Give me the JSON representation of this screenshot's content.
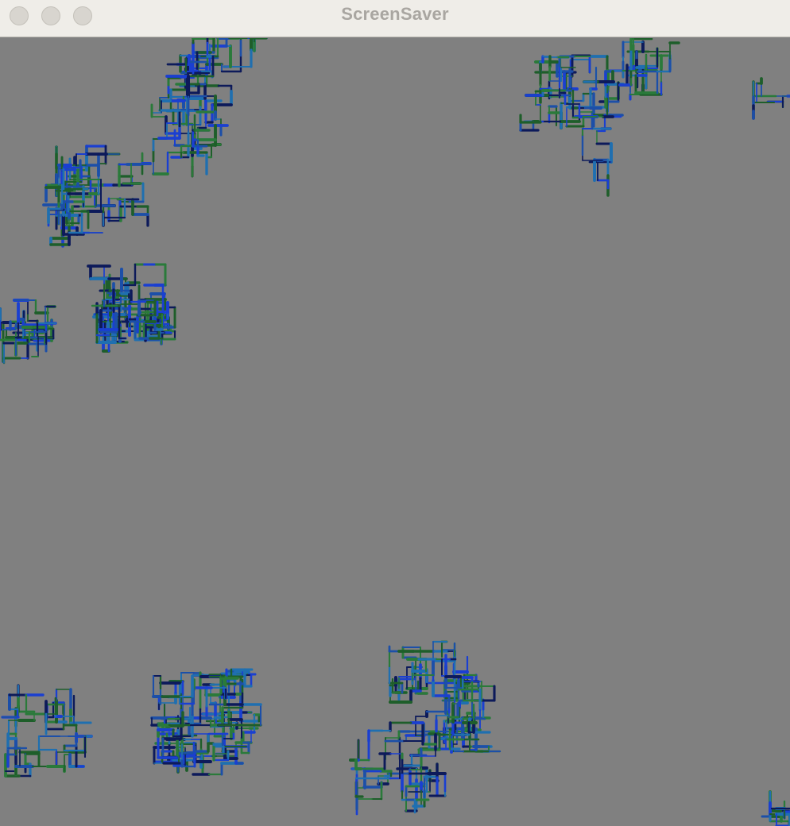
{
  "window": {
    "title": "ScreenSaver",
    "controls": [
      "close-button",
      "minimize-button",
      "zoom-button"
    ]
  },
  "canvas": {
    "background": "#808080",
    "trail_colors": [
      "#1a3fd1",
      "#1f6fb0",
      "#1e5e2a",
      "#0d1a5a",
      "#1c4fa8",
      "#2a7a3a"
    ]
  }
}
